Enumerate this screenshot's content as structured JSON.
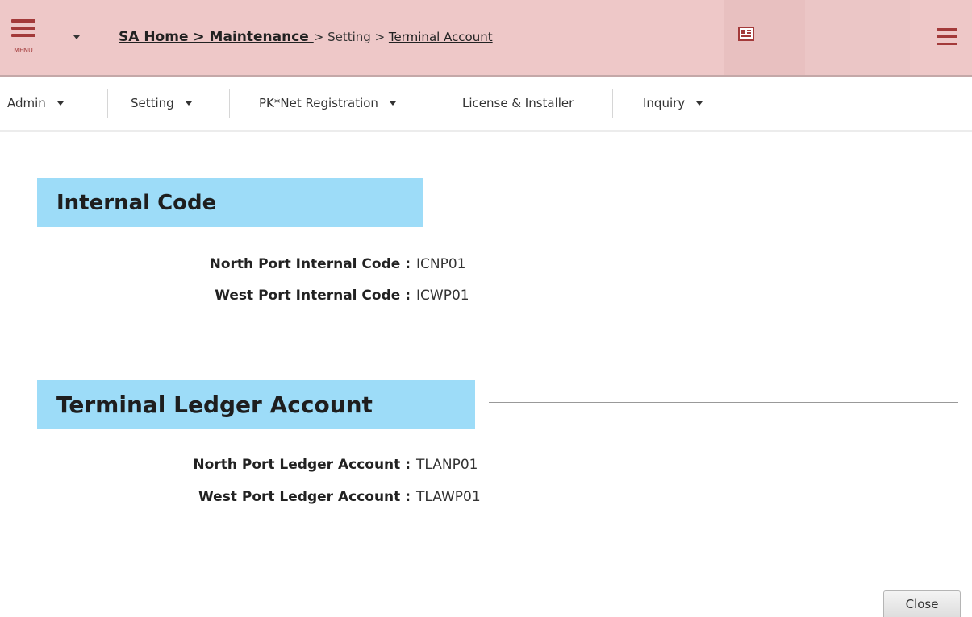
{
  "header": {
    "menu_label": "MENU",
    "breadcrumb": {
      "home": "SA Home > Maintenance ",
      "sep1": " > ",
      "setting": "Setting",
      "sep2": " > ",
      "current": "Terminal Account"
    },
    "icons": [
      "menu-icon",
      "caret-down-icon",
      "newspaper-icon",
      "hamburger-icon"
    ],
    "colors": {
      "header_bg": "#eec8c8",
      "accent": "#a33a3a"
    }
  },
  "nav": {
    "items": [
      {
        "label": "Admin",
        "dropdown": true
      },
      {
        "label": "Setting",
        "dropdown": true
      },
      {
        "label": "PK*Net Registration",
        "dropdown": true
      },
      {
        "label": "License & Installer",
        "dropdown": false
      },
      {
        "label": "Inquiry",
        "dropdown": true
      }
    ]
  },
  "sections": [
    {
      "title": "Internal Code",
      "fields": [
        {
          "label": "North Port Internal Code :",
          "value": "ICNP01"
        },
        {
          "label": "West Port Internal Code :",
          "value": "ICWP01"
        }
      ]
    },
    {
      "title": "Terminal Ledger Account",
      "fields": [
        {
          "label": "North Port Ledger Account :",
          "value": "TLANP01"
        },
        {
          "label": "West Port Ledger Account :",
          "value": "TLAWP01"
        }
      ]
    }
  ],
  "colors": {
    "section_bg": "#9ddcf8"
  },
  "close_label": "Close"
}
